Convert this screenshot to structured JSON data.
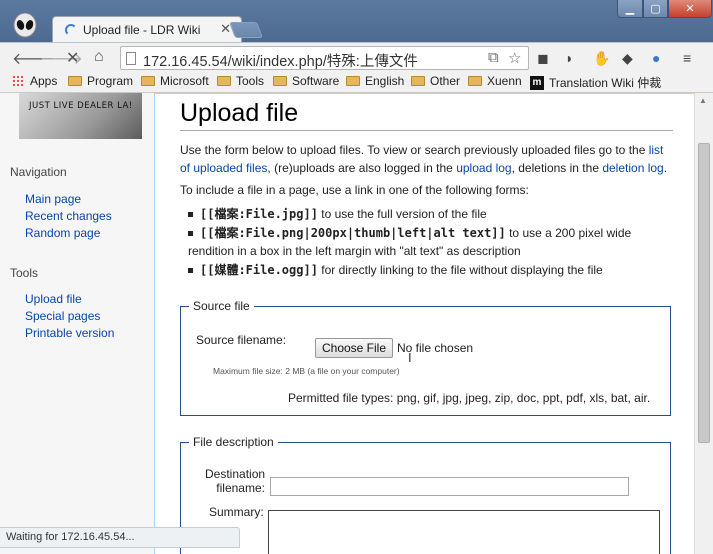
{
  "browser": {
    "tab_title": "Upload file - LDR Wiki",
    "url": "172.16.45.54/wiki/index.php/特殊:上傳文件",
    "status": "Waiting for 172.16.45.54..."
  },
  "bookmarks": [
    {
      "label": "Apps",
      "icon": "apps-grid-icon"
    },
    {
      "label": "Program",
      "icon": "folder-icon"
    },
    {
      "label": "Microsoft",
      "icon": "folder-icon"
    },
    {
      "label": "Tools",
      "icon": "folder-icon"
    },
    {
      "label": "Software",
      "icon": "folder-icon"
    },
    {
      "label": "English",
      "icon": "folder-icon"
    },
    {
      "label": "Other",
      "icon": "folder-icon"
    },
    {
      "label": "Xuenn",
      "icon": "folder-icon"
    },
    {
      "label": "Translation Wiki 仲裁",
      "icon": "m-logo-icon"
    }
  ],
  "sidebar": {
    "logo_text": "JUST LIVE DEALER LA!",
    "navigation_heading": "Navigation",
    "navigation": [
      "Main page",
      "Recent changes",
      "Random page"
    ],
    "tools_heading": "Tools",
    "tools": [
      "Upload file",
      "Special pages",
      "Printable version"
    ]
  },
  "main": {
    "title": "Upload file",
    "intro_1": "Use the form below to upload files. To view or search previously uploaded files go to the ",
    "intro_link_list": "list of uploaded files",
    "intro_2": ", (re)uploads are also logged in the ",
    "intro_link_upload_log": "upload log",
    "intro_3": ", deletions in the ",
    "intro_link_deletion_log": "deletion log",
    "intro_4": ".",
    "include_text": "To include a file in a page, use a link in one of the following forms:",
    "bullets": [
      {
        "code": "[[檔案:File.jpg]]",
        "text": " to use the full version of the file"
      },
      {
        "code": "[[檔案:File.png|200px|thumb|left|alt text]]",
        "text": " to use a 200 pixel wide rendition in a box in the left margin with \"alt text\" as description"
      },
      {
        "code": "[[媒體:File.ogg]]",
        "text": " for directly linking to the file without displaying the file"
      }
    ],
    "source_file": {
      "legend": "Source file",
      "filename_label": "Source filename:",
      "choose_button": "Choose File",
      "no_file": "No file chosen",
      "max_size": "Maximum file size: 2 MB (a file on your computer)",
      "permitted": "Permitted file types: png, gif, jpg, jpeg, zip, doc, ppt, pdf, xls, bat, air."
    },
    "file_description": {
      "legend": "File description",
      "destination_label_1": "Destination",
      "destination_label_2": "filename:",
      "destination_value": "",
      "summary_label": "Summary:"
    }
  },
  "colors": {
    "link": "#0645ad",
    "titlebar": "#5b7aa0",
    "fieldset_border": "#2a4b8d"
  }
}
